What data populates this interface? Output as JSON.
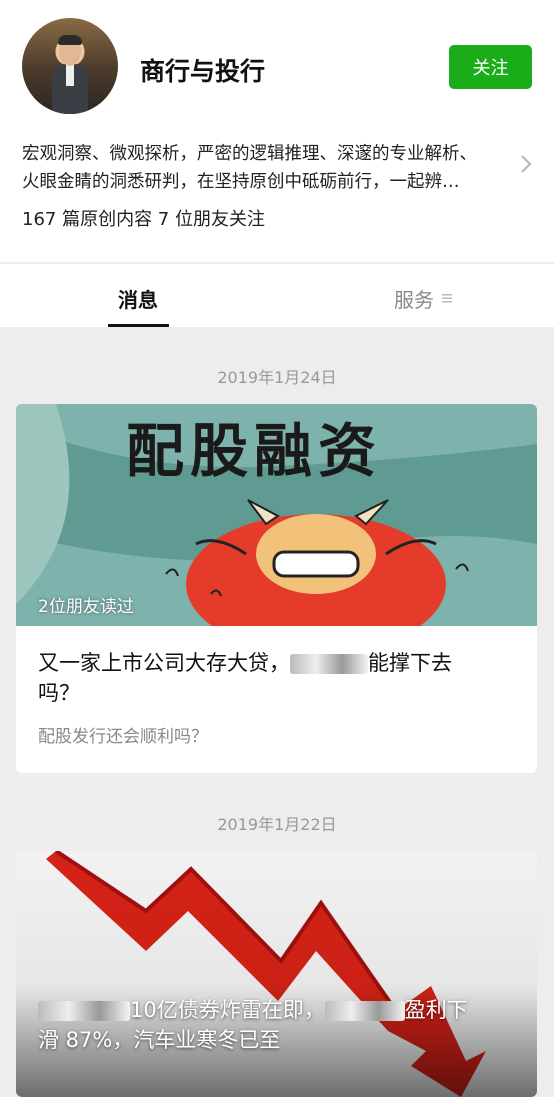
{
  "profile": {
    "name": "商行与投行",
    "follow_label": "关注",
    "description_line1": "宏观洞察、微观探析，严密的逻辑推理、深邃的专业解析、",
    "description_line2": "火眼金睛的洞悉研判，在坚持原创中砥砺前行，一起辨…",
    "stats": "167 篇原创内容  7 位朋友关注"
  },
  "tabs": {
    "messages": "消息",
    "services": "服务"
  },
  "feed": [
    {
      "date": "2019年1月24日",
      "image_caption": "配股融资",
      "friends_read": "2位朋友读过",
      "title_part1": "又一家上市公司大存大贷，",
      "title_part2": "能撑下去",
      "title_line2": "吗？",
      "subtitle": "配股发行还会顺利吗？"
    },
    {
      "date": "2019年1月22日",
      "title_part1": "10亿债券炸雷在即，",
      "title_part2": "盈利下",
      "title_line2": "滑 87%，汽车业寒冬已至"
    }
  ],
  "colors": {
    "accent_green": "#1aad19",
    "background": "#ededed"
  }
}
